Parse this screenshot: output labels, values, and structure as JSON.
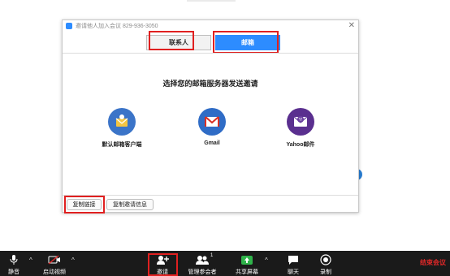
{
  "dialog": {
    "title": "邀请他人加入会议 829-936-3050",
    "close_label": "✕",
    "tabs": [
      {
        "label": "联系人"
      },
      {
        "label": "邮箱"
      }
    ],
    "heading": "选择您的邮箱服务器发送邀请",
    "services": [
      {
        "label": "默认邮箱客户端",
        "icon": "default-mail-icon",
        "color": "#3b74c8"
      },
      {
        "label": "Gmail",
        "icon": "gmail-icon",
        "color": "#2f6cc6"
      },
      {
        "label": "Yahoo邮件",
        "icon": "yahoo-mail-icon",
        "color": "#5a2f8f"
      }
    ],
    "copy_link_label": "复制链接",
    "copy_invite_label": "复制邀请信息"
  },
  "toolbar": {
    "mute_label": "静音",
    "video_label": "启动视频",
    "invite_label": "邀请",
    "participants_label": "管理参会者",
    "participants_count": "1",
    "share_label": "共享屏幕",
    "chat_label": "聊天",
    "record_label": "录制",
    "end_label": "结束会议",
    "caret": "^"
  },
  "colors": {
    "accent": "#2d8cff",
    "highlight": "#e02020",
    "toolbar_bg": "#1a1a1a",
    "share_green": "#2fb34a",
    "end_red": "#e02828"
  }
}
